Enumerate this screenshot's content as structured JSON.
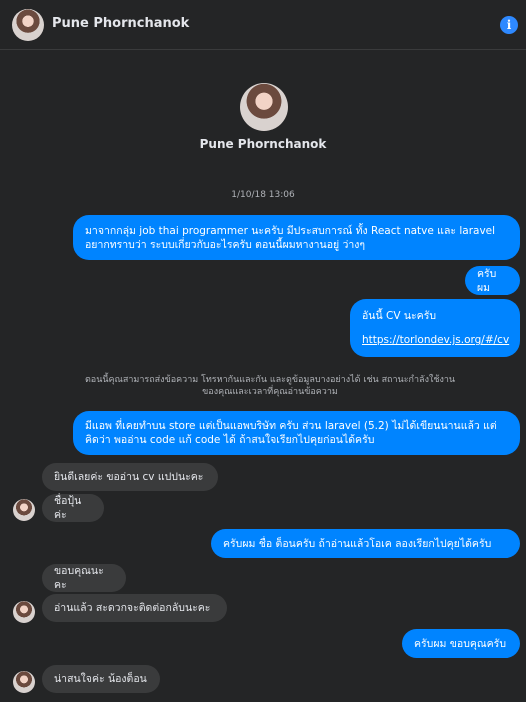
{
  "header": {
    "name": "Pune Phornchanok",
    "info_icon": "i"
  },
  "profile": {
    "name": "Pune Phornchanok"
  },
  "timestamp": "1/10/18 13:06",
  "messages": [
    {
      "from": "me",
      "text": "มาจากกลุ่ม job thai programmer นะครับ มีประสบการณ์ ทั้ง React natve และ laravel อยากทราบว่า ระบบเกี่ยวกับอะไรครับ ตอนนี้ผมหางานอยู่ ว่างๆ"
    },
    {
      "from": "me",
      "text": "ครับผม"
    },
    {
      "from": "me",
      "text": "อันนี้ CV นะครับ",
      "link": "https://torlondev.js.org/#/cv"
    },
    {
      "from": "me",
      "text": "มีแอพ ที่เคยทำบน store แต่เป็นแอพบริษัท ครับ ส่วน laravel (5.2) ไม่ได้เขียนนานแล้ว แต่คิดว่า พออ่าน code แก้ code ได้ ถ้าสนใจเรียกไปคุยก่อนได้ครับ"
    },
    {
      "from": "them",
      "text": "ยินดีเลยค่ะ ขออ่าน cv แปปนะคะ"
    },
    {
      "from": "them",
      "text": "ชื่อปุ้นค่ะ"
    },
    {
      "from": "me",
      "text": "ครับผม ชื่อ ต็อนครับ ถ้าอ่านแล้วโอเค ลองเรียกไปคุยได้ครับ"
    },
    {
      "from": "them",
      "text": "ขอบคุณนะคะ"
    },
    {
      "from": "them",
      "text": "อ่านแล้ว สะดวกจะติดต่อกลับนะคะ"
    },
    {
      "from": "me",
      "text": "ครับผม ขอบคุณครับ"
    },
    {
      "from": "them",
      "text": "น่าสนใจค่ะ น้องต็อน"
    }
  ],
  "notice": "ตอนนี้คุณสามารถส่งข้อความ โทรหากันและกัน และดูข้อมูลบางอย่างได้ เช่น สถานะกำลังใช้งานของคุณและเวลาที่คุณอ่านข้อความ",
  "colors": {
    "outgoing": "#0084ff",
    "incoming": "#3a3b3c",
    "background": "#242526",
    "info": "#2e89ff"
  },
  "icons": {
    "header": "info-icon"
  }
}
